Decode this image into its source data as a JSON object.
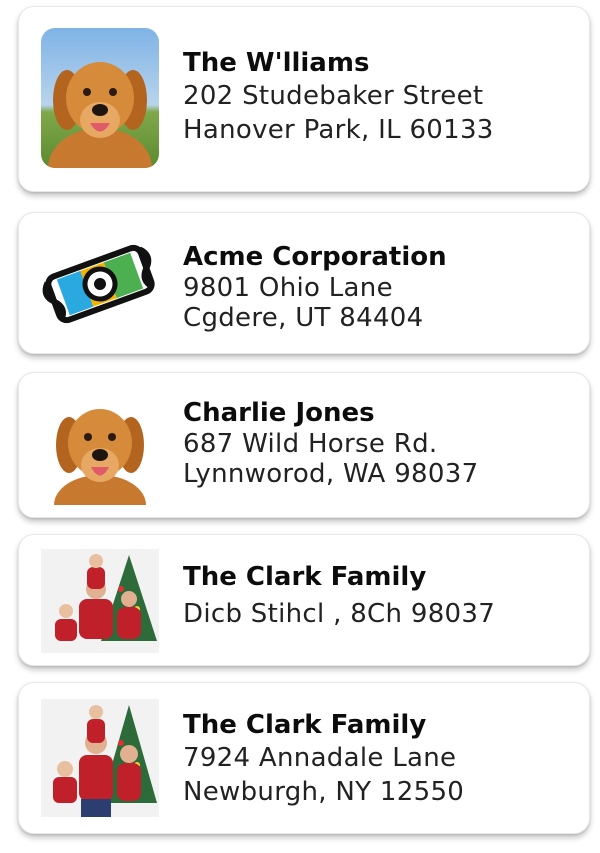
{
  "labels": [
    {
      "name": "The W'lliams",
      "line1": "202 Studebaker Street",
      "line2": "Hanover Park, IL 60133",
      "image": "golden-retriever-photo"
    },
    {
      "name": "Acme Corporation",
      "line1": "9801 Ohio Lane",
      "line2": "Cgdere, UT 84404",
      "image": "film-scroll-logo"
    },
    {
      "name": "Charlie Jones",
      "line1": "687 Wild Horse Rd.",
      "line2": "Lynnwor​od, WA 98037",
      "image": "golden-retriever-photo"
    },
    {
      "name": "The Clark Family",
      "line1": "Dicb Stihcl , 8Ch 98037",
      "line2": "",
      "image": "family-christmas-photo"
    },
    {
      "name": "The Clark Family",
      "line1": "7924 Annadale Lane",
      "line2": "Newburgh, NY 12550",
      "image": "family-christmas-photo"
    }
  ]
}
